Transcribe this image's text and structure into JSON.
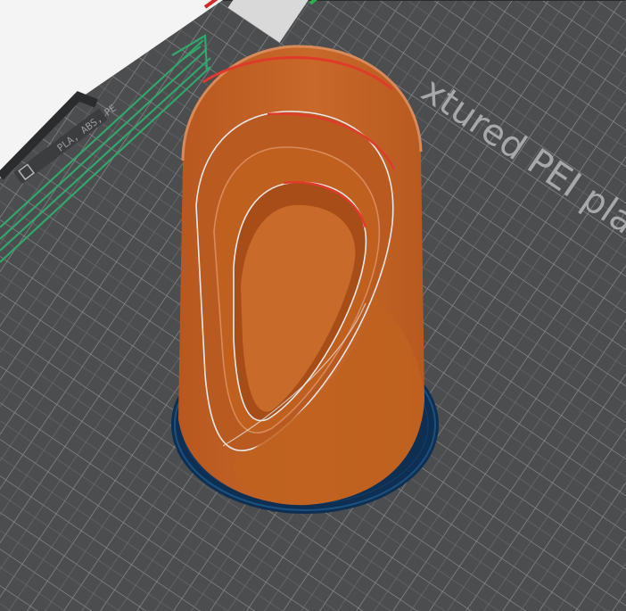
{
  "app": {
    "view": "3D print preview"
  },
  "plate": {
    "label": "xtured PEI plate",
    "logo_text": "PLA, ABS, PE",
    "surface_color": "#4b4d4f",
    "grid_color": "#8e9092",
    "border_color": "#2f3133"
  },
  "model": {
    "shell_color": "#c56427",
    "shell_dark_color": "#a84f1c",
    "highlight_color": "#e03a2a",
    "edge_color": "#e8e8e8"
  },
  "brim": {
    "color": "#0f3a63"
  },
  "axis": {
    "x_color": "#d42a2a",
    "y_color": "#2ab24a"
  },
  "wipe_tower": {
    "color": "#2fa86a"
  }
}
